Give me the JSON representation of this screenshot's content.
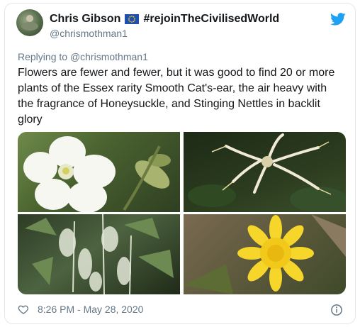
{
  "author": {
    "display_name": "Chris Gibson",
    "tag": "#rejoinTheCivilisedWorld",
    "handle": "@chrismothman1",
    "flag_icon": "eu-flag-icon",
    "avatar_icon": "avatar-photo"
  },
  "reply": {
    "prefix": "Replying to",
    "handle": "@chrismothman1"
  },
  "tweet": {
    "text": "Flowers are fewer and fewer, but it was good to find 20 or more plants of the Essex rarity Smooth Cat's-ear, the air heavy with the fragrance of Honeysuckle, and Stinging Nettles in backlit glory"
  },
  "media": {
    "photos": [
      {
        "subject": "white-campion-photo"
      },
      {
        "subject": "honeysuckle-photo"
      },
      {
        "subject": "stinging-nettles-photo"
      },
      {
        "subject": "smooth-cats-ear-photo"
      }
    ]
  },
  "footer": {
    "timestamp": "8:26 PM - May 28, 2020",
    "like_icon": "heart-icon",
    "info_icon": "info-icon"
  },
  "colors": {
    "brand_blue": "#1da1f2",
    "secondary_text": "#657786",
    "primary_text": "#14171a",
    "border": "#e1e8ed"
  }
}
